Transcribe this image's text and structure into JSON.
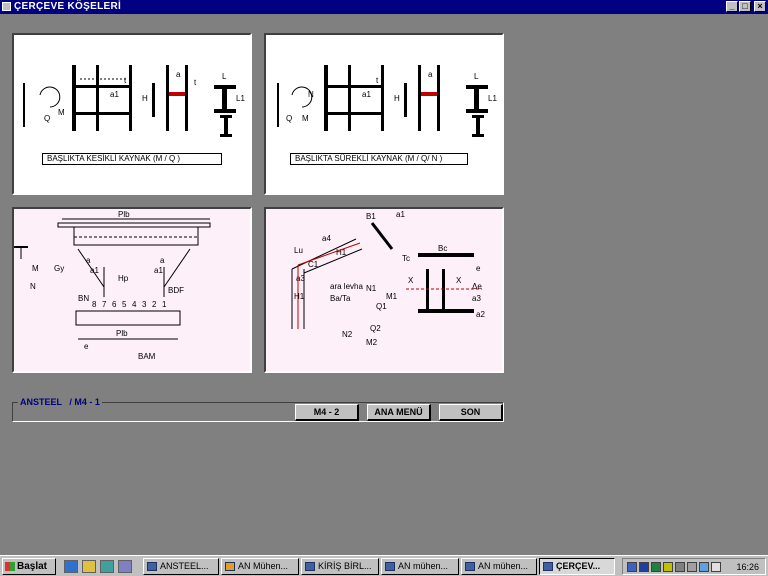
{
  "window": {
    "title": "ÇERÇEVE KÖŞELERİ"
  },
  "panels": {
    "p1": {
      "caption": "BAŞLIKTA KESİKLİ KAYNAK   (M / Q )",
      "labels": {
        "Q": "Q",
        "M": "M",
        "a": "a",
        "a1": "a1",
        "t": "t",
        "H": "H",
        "L": "L",
        "L1": "L1"
      }
    },
    "p2": {
      "caption": "BAŞLIKTA SÜREKLİ KAYNAK   (M / Q/ N )",
      "labels": {
        "Q": "Q",
        "M": "M",
        "N": "N",
        "a": "a",
        "a1": "a1",
        "t": "t",
        "H": "H",
        "L": "L",
        "L1": "L1"
      }
    },
    "p3": {
      "labels": {
        "Plb_top": "Plb",
        "M": "M",
        "N": "N",
        "Gy": "Gy",
        "a": "a",
        "a1": "a1",
        "Hp": "Hp",
        "BN": "BN",
        "bolts": [
          "8",
          "7",
          "6",
          "5",
          "4",
          "3",
          "2",
          "1"
        ],
        "BDF": "BDF",
        "Plb_bottom": "Plb",
        "e": "e",
        "BAM": "BAM"
      }
    },
    "p4": {
      "labels": {
        "B1": "B1",
        "a1": "a1",
        "a4": "a4",
        "Lu": "Lu",
        "H1": "H1",
        "C1": "C1",
        "a3": "a3",
        "ara_levha": "ara levha",
        "Ba_Ta": "Ba/Ta",
        "N1": "N1",
        "M1": "M1",
        "Q1": "Q1",
        "N2": "N2",
        "Q2": "Q2",
        "M2": "M2",
        "Bc": "Bc",
        "Tc": "Tc",
        "e": "e",
        "ae": "Δe",
        "a2": "a2",
        "X": "X"
      }
    }
  },
  "status": {
    "label": "ANSTEEL   / M4 - 1"
  },
  "buttons": {
    "m4_2": "M4 - 2",
    "ana_menu": "ANA MENÜ",
    "son": "SON"
  },
  "taskbar": {
    "start": "Başlat",
    "tasks": [
      "ANSTEEL...",
      "AN Mühen...",
      "KİRİŞ BİRL...",
      "AN mühen...",
      "AN mühen...",
      "ÇERÇEV..."
    ],
    "clock": "16:26"
  }
}
